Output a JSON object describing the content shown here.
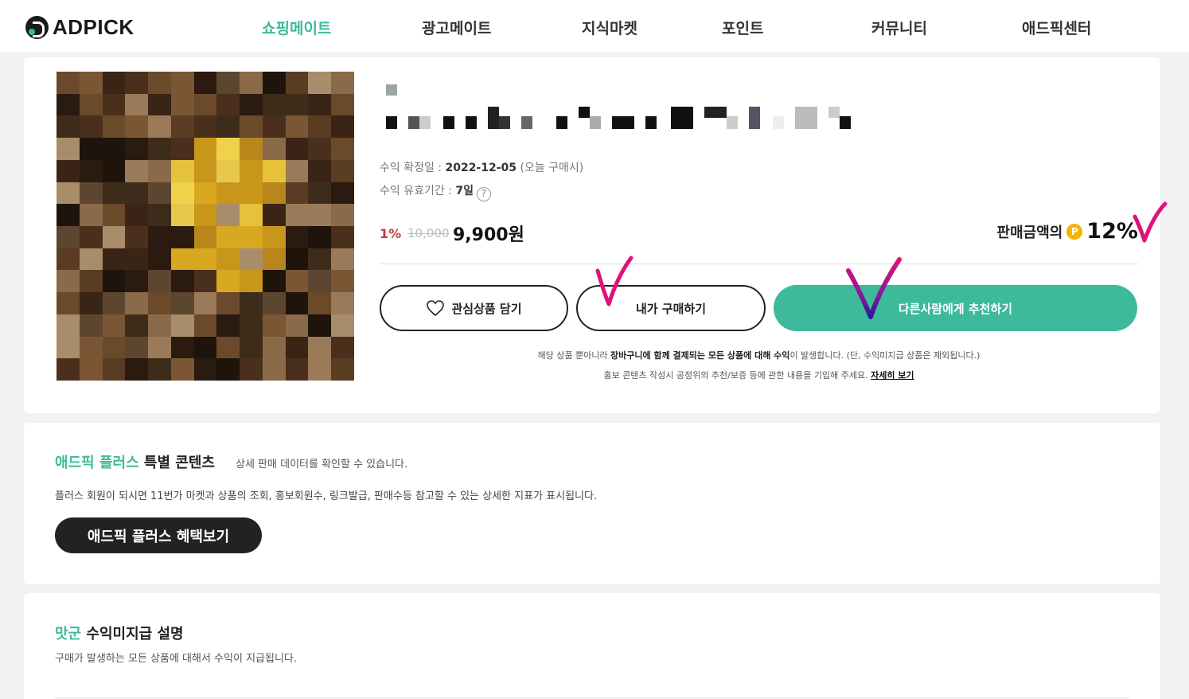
{
  "header": {
    "logo_text": "ADPICK",
    "nav": [
      {
        "label": "쇼핑메이트",
        "active": true
      },
      {
        "label": "광고메이트",
        "active": false
      },
      {
        "label": "지식마켓",
        "active": false
      },
      {
        "label": "포인트",
        "active": false
      },
      {
        "label": "커뮤니티",
        "active": false
      },
      {
        "label": "애드픽센터",
        "active": false
      }
    ]
  },
  "product": {
    "confirm_label": "수익 확정일 : ",
    "confirm_date": "2022-12-05",
    "confirm_note": " (오늘 구매시)",
    "valid_label": "수익 유효기간 : ",
    "valid_value": "7일",
    "help_icon": "?",
    "discount": "1%",
    "original_price": "10,000",
    "sale_price": "9,900원",
    "reward_label": "판매금액의",
    "reward_icon": "P",
    "reward_value": "12%"
  },
  "buttons": {
    "wish": "관심상품 담기",
    "buy": "내가 구매하기",
    "recommend": "다른사람에게 추천하기"
  },
  "notice": {
    "line1_pre": "해당 상품 뿐아니라 ",
    "line1_bold": "장바구니에 함께 결제되는 모든 상품에 대해 수익",
    "line1_post": "이 발생합니다. (단, 수익미지급 상품은 제외됩니다.)",
    "line2_pre": "홍보 콘텐츠 작성시 공정위의 추천/보증 등에 관한 내용을 기입해 주세요. ",
    "line2_link": "자세히 보기"
  },
  "plus": {
    "title_accent": "애드픽 플러스",
    "title_rest": " 특별 콘텐츠",
    "subtitle": "상세 판매 데이터를 확인할 수 있습니다.",
    "description": "플러스 회원이 되시면 11번가 마켓과 상품의 조회, 홍보회원수, 링크발급, 판매수등 참고할 수 있는 상세한 지표가 표시됩니다.",
    "button": "애드픽 플러스 혜택보기"
  },
  "section3": {
    "title_accent": "맛군",
    "title_rest": " 수익미지급 설명",
    "description": "구매가 발생하는 모든 상품에 대해서 수익이 지급됩니다."
  },
  "colors": {
    "accent": "#3db99c",
    "discount": "#c43b3b",
    "point": "#f5b400",
    "annotation_pink": "#e0127a",
    "annotation_purple": "#3a1a9c"
  }
}
